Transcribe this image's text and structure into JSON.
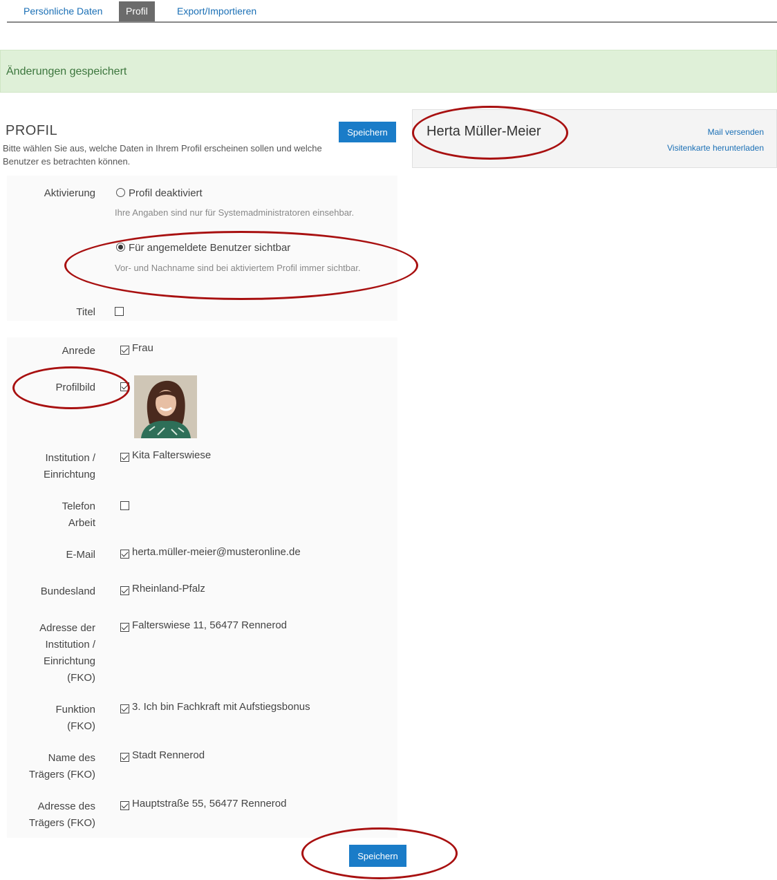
{
  "tabs": [
    {
      "label": "Persönliche Daten",
      "active": false
    },
    {
      "label": "Profil",
      "active": true
    },
    {
      "label": "Export/Importieren",
      "active": false
    }
  ],
  "alert": {
    "text": "Änderungen gespeichert"
  },
  "profile": {
    "title": "PROFIL",
    "description": "Bitte wählen Sie aus, welche Daten in Ihrem Profil erscheinen sollen und welche Benutzer es betrachten können.",
    "save_label": "Speichern"
  },
  "card": {
    "name": "Herta Müller-Meier",
    "mail_link": "Mail versenden",
    "vcard_link": "Visitenkarte herunterladen"
  },
  "activation": {
    "label": "Aktivierung",
    "options": [
      {
        "label": "Profil deaktiviert",
        "help": "Ihre Angaben sind nur für Systemadministratoren einsehbar.",
        "selected": false
      },
      {
        "label": "Für angemeldete Benutzer sichtbar",
        "help": "Vor- und Nachname sind bei aktiviertem Profil immer sichtbar.",
        "selected": true
      }
    ]
  },
  "fields": {
    "titel": {
      "label": "Titel",
      "checked": false,
      "value": ""
    },
    "anrede": {
      "label": "Anrede",
      "checked": true,
      "value": "Frau"
    },
    "profilbild": {
      "label": "Profilbild",
      "checked": true
    },
    "institution": {
      "label_1": "Institution /",
      "label_2": "Einrichtung",
      "checked": true,
      "value": "Kita Falterswiese"
    },
    "telefon": {
      "label_1": "Telefon",
      "label_2": "Arbeit",
      "checked": false,
      "value": ""
    },
    "email": {
      "label": "E-Mail",
      "checked": true,
      "value": "herta.müller-meier@musteronline.de"
    },
    "bundesland": {
      "label": "Bundesland",
      "checked": true,
      "value": "Rheinland-Pfalz"
    },
    "adresse_institution": {
      "label_1": "Adresse der",
      "label_2": "Institution /",
      "label_3": "Einrichtung",
      "label_4": "(FKO)",
      "checked": true,
      "value": "Falterswiese 11, 56477 Rennerod"
    },
    "funktion": {
      "label_1": "Funktion",
      "label_2": "(FKO)",
      "checked": true,
      "value": "3. Ich bin Fachkraft mit Aufstiegsbonus"
    },
    "traeger_name": {
      "label_1": "Name des",
      "label_2": "Trägers (FKO)",
      "checked": true,
      "value": "Stadt Rennerod"
    },
    "traeger_adresse": {
      "label_1": "Adresse des",
      "label_2": "Trägers (FKO)",
      "checked": true,
      "value": "Hauptstraße 55, 56477 Rennerod"
    }
  },
  "colors": {
    "primary": "#1a7cc8",
    "link": "#1a6fb5",
    "alert_bg": "#dff0d8",
    "alert_text": "#3c763d",
    "annotation": "#a81010"
  }
}
